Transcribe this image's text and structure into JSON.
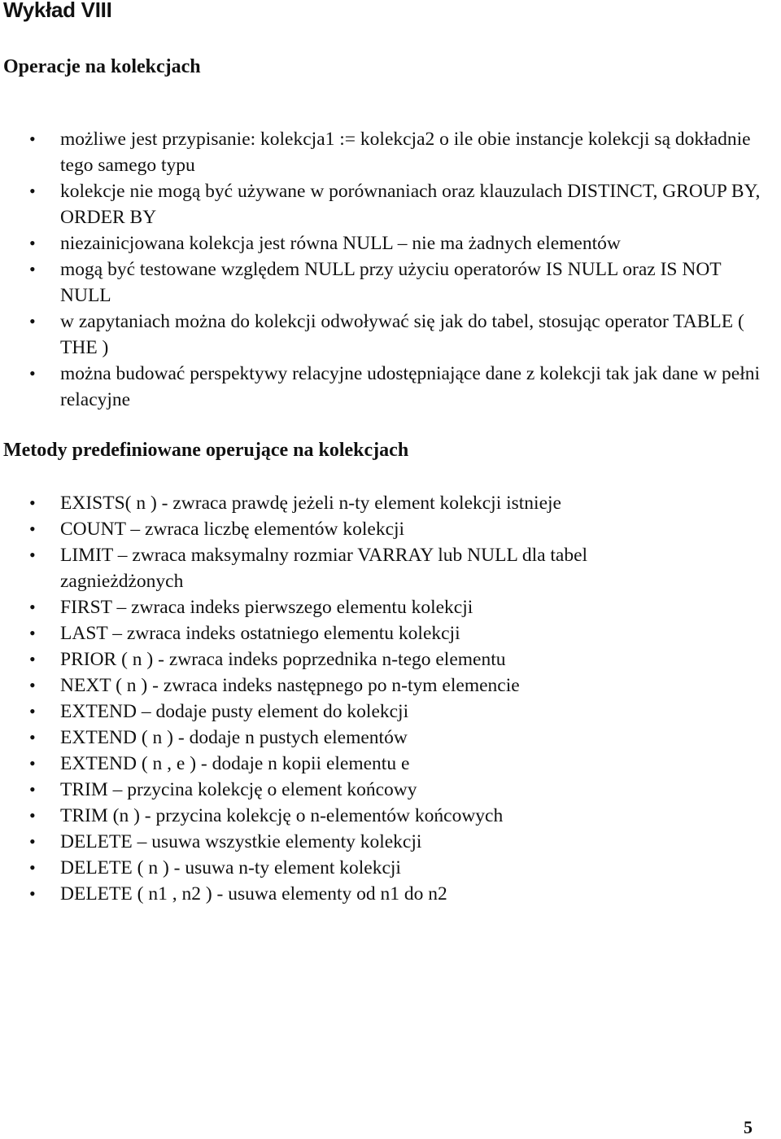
{
  "document": {
    "title": "Wykład VIII",
    "section1": {
      "heading": "Operacje na kolekcjach",
      "items": [
        "możliwe jest przypisanie: kolekcja1 := kolekcja2 o ile obie instancje kolekcji są dokładnie tego samego typu",
        "kolekcje nie mogą być używane w porównaniach oraz klauzulach DISTINCT, GROUP  BY, ORDER  BY",
        "niezainicjowana kolekcja jest równa NULL – nie ma żadnych elementów",
        "mogą być testowane względem NULL przy użyciu operatorów IS  NULL oraz IS NOT  NULL",
        "w zapytaniach można do kolekcji odwoływać się jak do tabel, stosując operator TABLE ( THE )",
        "można budować perspektywy relacyjne udostępniające dane z kolekcji tak jak dane w pełni relacyjne"
      ]
    },
    "section2": {
      "heading": "Metody predefiniowane operujące na kolekcjach",
      "items": [
        "EXISTS( n ) - zwraca prawdę jeżeli n-ty element kolekcji istnieje",
        "COUNT – zwraca liczbę elementów kolekcji",
        "LIMIT – zwraca maksymalny rozmiar VARRAY lub NULL dla tabel zagnieżdżonych",
        "FIRST – zwraca indeks pierwszego elementu kolekcji",
        "LAST – zwraca indeks ostatniego elementu kolekcji",
        "PRIOR ( n ) - zwraca indeks poprzednika n-tego elementu",
        "NEXT ( n ) - zwraca indeks następnego po n-tym elemencie",
        "EXTEND – dodaje pusty element do kolekcji",
        "EXTEND ( n ) - dodaje n pustych elementów",
        "EXTEND ( n , e ) - dodaje n kopii elementu e",
        "TRIM – przycina kolekcję o element końcowy",
        "TRIM (n ) - przycina kolekcję o n-elementów końcowych",
        "DELETE – usuwa wszystkie elementy kolekcji",
        "DELETE ( n ) - usuwa n-ty element kolekcji",
        "DELETE ( n1 , n2 ) - usuwa elementy od n1 do n2"
      ]
    },
    "bullet_glyph": "•",
    "page_number": "5"
  }
}
